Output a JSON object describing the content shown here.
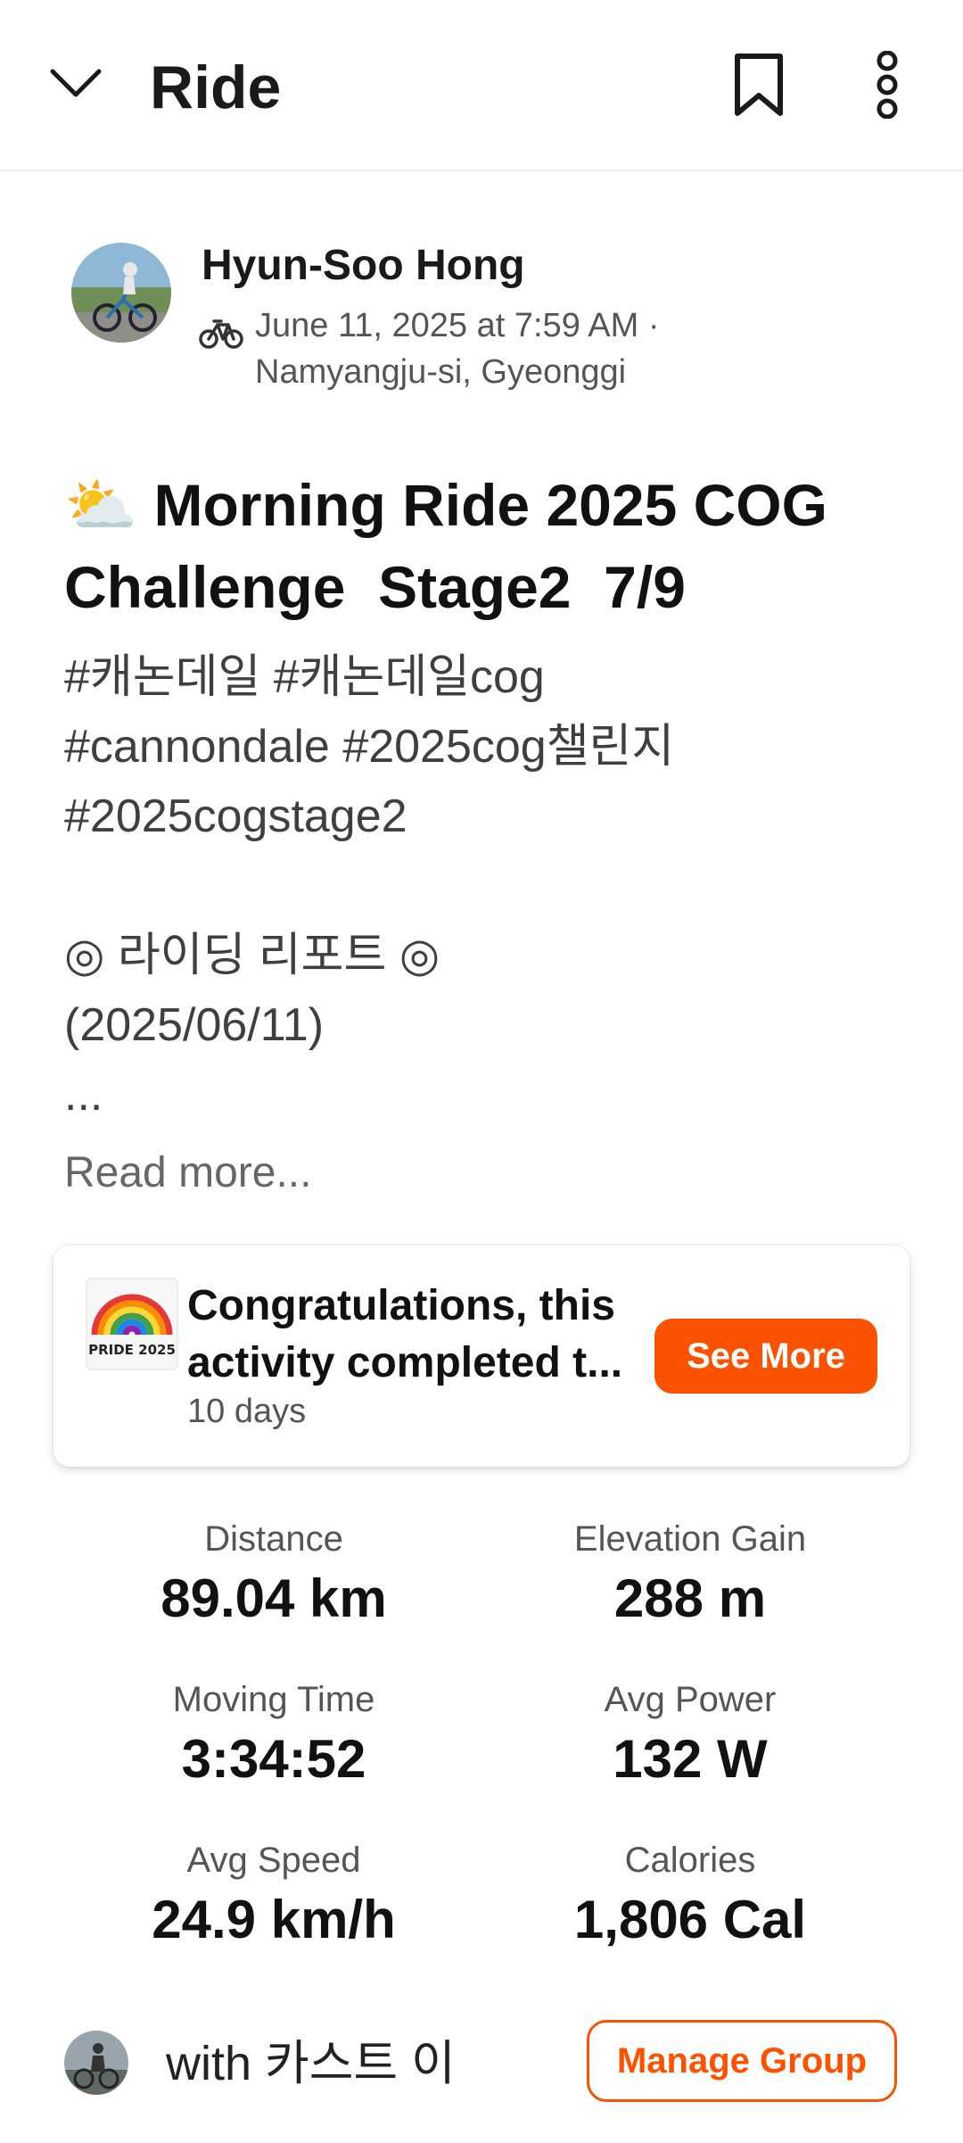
{
  "header": {
    "title": "Ride",
    "icons": {
      "back": "chevron-down-icon",
      "bookmark": "bookmark-icon",
      "more": "more-vertical-icon"
    }
  },
  "athlete": {
    "name": "Hyun-Soo Hong",
    "activity_icon": "bicycle-icon",
    "date_line": "June 11, 2025 at 7:59 AM ·",
    "location": "Namyangju-si, Gyeonggi"
  },
  "activity": {
    "title": "⛅ Morning Ride 2025 COG Challenge  Stage2  7/9",
    "description": "#캐논데일 #캐논데일cog\n#cannondale #2025cog챌린지\n#2025cogstage2\n\n◎ 라이딩 리포트 ◎\n(2025/06/11)\n...",
    "read_more": "Read more..."
  },
  "achievement": {
    "badge_text": "PRIDE 2025",
    "title_line1": "Congratulations, this",
    "title_line2": "activity completed t...",
    "subtitle": "10 days",
    "button_label": "See More"
  },
  "stats": [
    {
      "label": "Distance",
      "value": "89.04 km"
    },
    {
      "label": "Elevation Gain",
      "value": "288 m"
    },
    {
      "label": "Moving Time",
      "value": "3:34:52"
    },
    {
      "label": "Avg Power",
      "value": "132 W"
    },
    {
      "label": "Avg Speed",
      "value": "24.9 km/h"
    },
    {
      "label": "Calories",
      "value": "1,806 Cal"
    }
  ],
  "group": {
    "text": "with 카스트 이",
    "button_label": "Manage Group"
  },
  "colors": {
    "accent": "#fc5200",
    "text_primary": "#111111",
    "text_secondary": "#555555"
  }
}
